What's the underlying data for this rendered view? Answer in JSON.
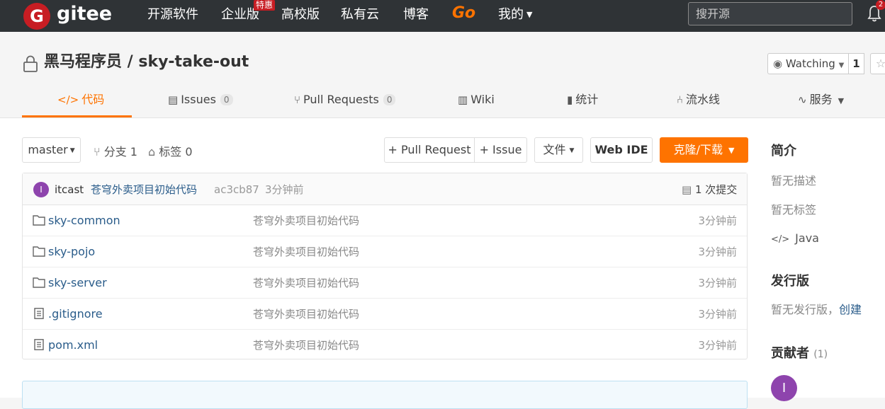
{
  "nav": {
    "logo_letter": "G",
    "logo_text": "gitee",
    "items": [
      "开源软件",
      "企业版",
      "高校版",
      "私有云",
      "博客"
    ],
    "badge": "特惠",
    "go_label": "Go",
    "mine": "我的",
    "search_placeholder": "搜开源",
    "notification_count": "2"
  },
  "repo": {
    "title": "黑马程序员 / sky-take-out",
    "watch_label": "Watching",
    "watch_count": "1",
    "tabs": [
      {
        "icon": "</>",
        "label": "代码"
      },
      {
        "icon": "",
        "label": "Issues",
        "count": "0"
      },
      {
        "icon": "",
        "label": "Pull Requests",
        "count": "0"
      },
      {
        "icon": "",
        "label": "Wiki"
      },
      {
        "icon": "",
        "label": "统计"
      },
      {
        "icon": "",
        "label": "流水线"
      },
      {
        "icon": "",
        "label": "服务"
      }
    ]
  },
  "toolbar": {
    "branch": "master",
    "branches": "分支 1",
    "tags": "标签 0",
    "pull_request": "+ Pull Request",
    "issue": "+ Issue",
    "file": "文件",
    "web_ide": "Web IDE",
    "clone": "克隆/下载"
  },
  "commit": {
    "avatar_letter": "I",
    "author": "itcast",
    "message": "苍穹外卖项目初始代码",
    "hash": "ac3cb87",
    "time": "3分钟前",
    "count": "1 次提交"
  },
  "files": [
    {
      "type": "folder",
      "name": "sky-common",
      "message": "苍穹外卖项目初始代码",
      "time": "3分钟前"
    },
    {
      "type": "folder",
      "name": "sky-pojo",
      "message": "苍穹外卖项目初始代码",
      "time": "3分钟前"
    },
    {
      "type": "folder",
      "name": "sky-server",
      "message": "苍穹外卖项目初始代码",
      "time": "3分钟前"
    },
    {
      "type": "file",
      "name": ".gitignore",
      "message": "苍穹外卖项目初始代码",
      "time": "3分钟前"
    },
    {
      "type": "file",
      "name": "pom.xml",
      "message": "苍穹外卖项目初始代码",
      "time": "3分钟前"
    }
  ],
  "sidebar": {
    "intro_title": "简介",
    "no_desc": "暂无描述",
    "no_tags": "暂无标签",
    "language": "Java",
    "release_title": "发行版",
    "no_release": "暂无发行版，",
    "create": "创建",
    "contributors_title": "贡献者",
    "contributors_count": "(1)",
    "contributor_letter": "I"
  },
  "colors": {
    "accent": "#fe7300",
    "brand": "#c71d23",
    "nav_bg": "#2f3336"
  }
}
